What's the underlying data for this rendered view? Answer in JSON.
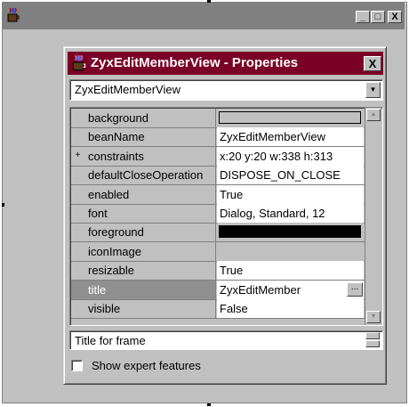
{
  "dialog": {
    "title": "ZyxEditMemberView - Properties",
    "close_label": "X",
    "bean_select": {
      "value": "ZyxEditMemberView"
    }
  },
  "outer_window": {
    "minimize_label": "_",
    "maximize_label": "□",
    "close_label": "X"
  },
  "properties": [
    {
      "name": "background",
      "value": "",
      "swatch": "#c0c0c0"
    },
    {
      "name": "beanName",
      "value": "ZyxEditMemberView"
    },
    {
      "name": "constraints",
      "value": "x:20 y:20 w:338 h:313",
      "expand": "+"
    },
    {
      "name": "defaultCloseOperation",
      "value": "DISPOSE_ON_CLOSE"
    },
    {
      "name": "enabled",
      "value": "True"
    },
    {
      "name": "font",
      "value": "Dialog, Standard, 12"
    },
    {
      "name": "foreground",
      "value": "",
      "swatch": "#000000"
    },
    {
      "name": "iconImage",
      "value": ""
    },
    {
      "name": "resizable",
      "value": "True"
    },
    {
      "name": "title",
      "value": "ZyxEditMember",
      "selected": true,
      "button": "..."
    },
    {
      "name": "visible",
      "value": "False"
    }
  ],
  "description": "Title for frame",
  "expert_checkbox": {
    "label": "Show expert features",
    "checked": false
  },
  "colors": {
    "dialog_title_bg": "#7b0027",
    "selected_row_bg": "#8f8f8f",
    "face": "#c0c0c0"
  }
}
